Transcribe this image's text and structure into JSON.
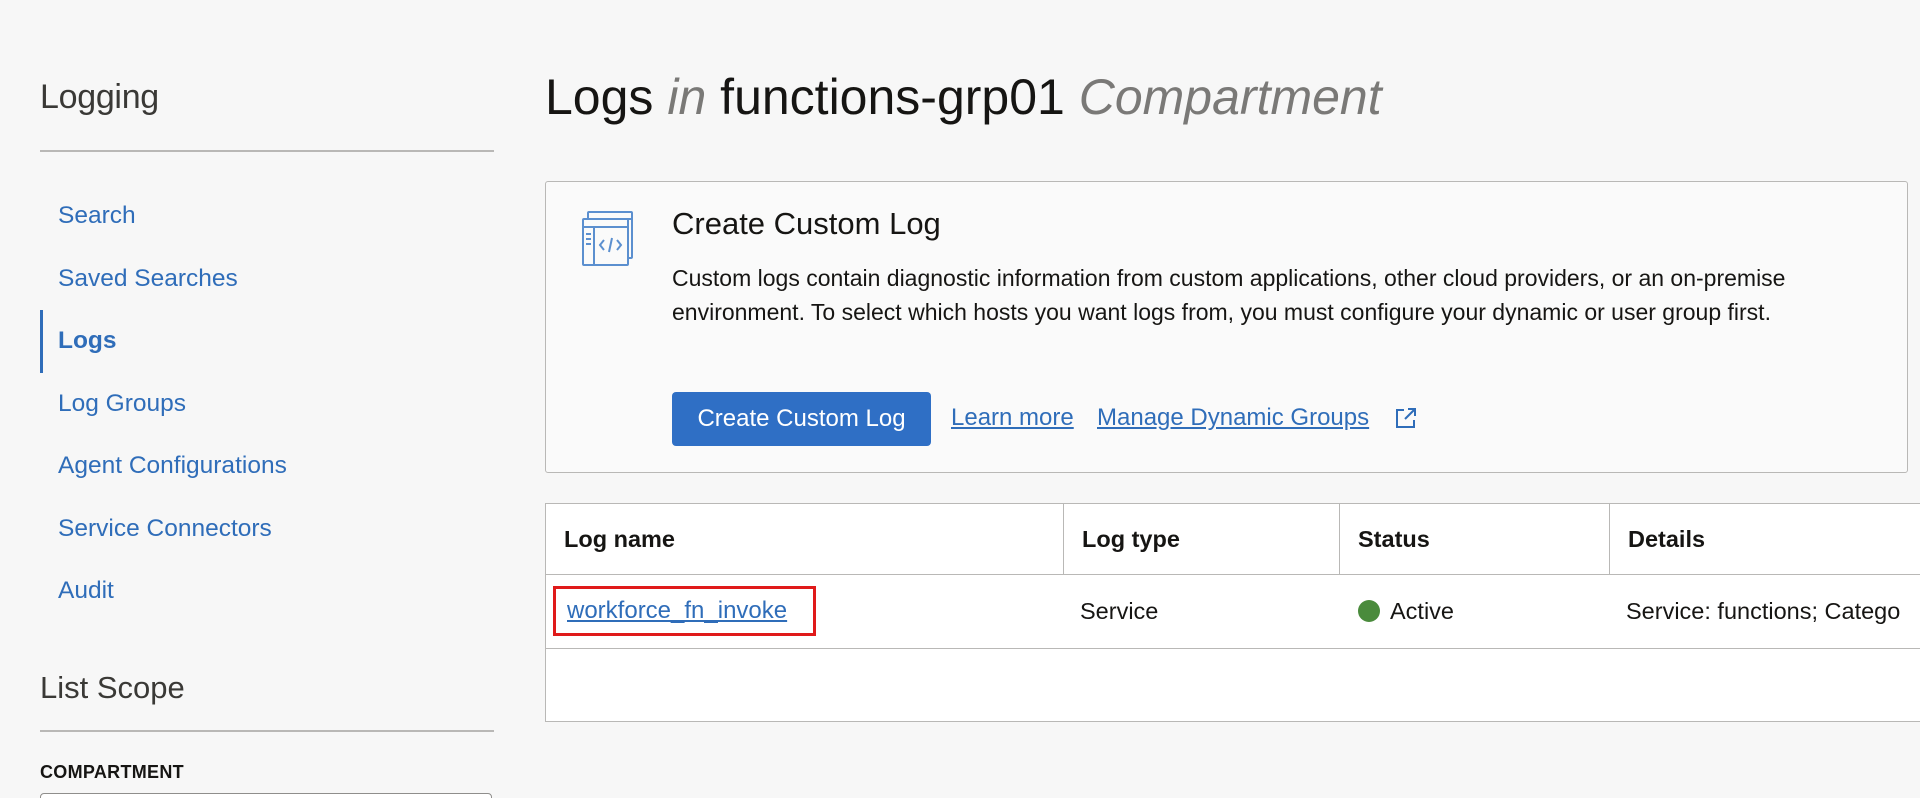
{
  "sidebar": {
    "title": "Logging",
    "items": [
      {
        "label": "Search",
        "active": false
      },
      {
        "label": "Saved Searches",
        "active": false
      },
      {
        "label": "Logs",
        "active": true
      },
      {
        "label": "Log Groups",
        "active": false
      },
      {
        "label": "Agent Configurations",
        "active": false
      },
      {
        "label": "Service Connectors",
        "active": false
      },
      {
        "label": "Audit",
        "active": false
      }
    ],
    "scope_title": "List Scope",
    "compartment_label": "COMPARTMENT"
  },
  "header": {
    "title_logs": "Logs",
    "title_in": "in",
    "compartment_name": "functions-grp01",
    "title_compartment": "Compartment"
  },
  "info": {
    "icon": "code-window-icon",
    "heading": "Create Custom Log",
    "text": "Custom logs contain diagnostic information from custom applications, other cloud providers, or an on-premise environment. To select which hosts you want logs from, you must configure your dynamic or user group first.",
    "create_button": "Create Custom Log",
    "learn_more": "Learn more",
    "manage_groups": "Manage Dynamic Groups"
  },
  "table": {
    "columns": [
      "Log name",
      "Log type",
      "Status",
      "Details"
    ],
    "rows": [
      {
        "log_name": "workforce_fn_invoke",
        "log_type": "Service",
        "status": "Active",
        "details": "Service: functions; Catego"
      }
    ]
  },
  "colors": {
    "accent": "#2f6fc5",
    "link": "#2f6db9",
    "status_active": "#4a8b3c",
    "highlight": "#e01a1a"
  }
}
